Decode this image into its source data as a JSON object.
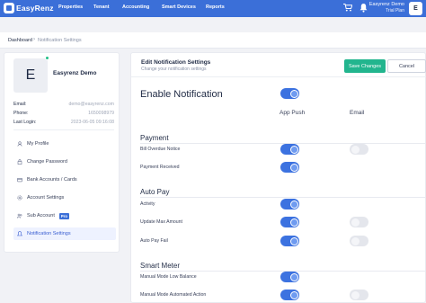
{
  "brand": {
    "name": "EasyRenz"
  },
  "nav": {
    "items": [
      "Properties",
      "Tenant",
      "Accounting",
      "Smart Devices",
      "Reports"
    ]
  },
  "topuser": {
    "name": "Easyrenz Demo",
    "plan": "Trial Plan",
    "avatar": "E"
  },
  "breadcrumb": {
    "home": "Dashboard",
    "sep": "›",
    "current": "Notification Settings"
  },
  "profile": {
    "avatar": "E",
    "name": "Easyrenz Demo",
    "email_label": "Email:",
    "email": "demo@easyrenz.com",
    "phone_label": "Phone:",
    "phone": "1650098979",
    "login_label": "Last Login:",
    "login": "2023-06-05 09:16:08"
  },
  "menu": {
    "items": [
      "My Profile",
      "Change Password",
      "Bank Accounts / Cards",
      "Account Settings",
      "Sub Account",
      "Notification Settings"
    ],
    "pro_badge": "Pro"
  },
  "main": {
    "title": "Edit Notification Settings",
    "subtitle": "Change your notification settings",
    "save": "Save Changes",
    "cancel": "Cancel",
    "enable": "Enable Notification",
    "col_app": "App Push",
    "col_email": "Email",
    "payment": {
      "title": "Payment",
      "rows": [
        "Bill Overdue Notice",
        "Payment Received"
      ]
    },
    "autopay": {
      "title": "Auto Pay",
      "rows": [
        "Activity",
        "Update Max Amount",
        "Auto Pay Fail"
      ]
    },
    "smartmeter": {
      "title": "Smart Meter",
      "rows": [
        "Manual Mode Low Balance",
        "Manual Mode Automated Action"
      ]
    }
  },
  "toggles": {
    "enable": true,
    "bill_overdue": {
      "app": true,
      "email": false
    },
    "payment_received": {
      "app": true,
      "email": null
    },
    "activity": {
      "app": true,
      "email": null
    },
    "update_max": {
      "app": true,
      "email": false
    },
    "autopay_fail": {
      "app": true,
      "email": false
    },
    "low_balance": {
      "app": true,
      "email": null
    },
    "automated_action": {
      "app": true,
      "email": false
    }
  },
  "colors": {
    "primary": "#3b6fd8",
    "success": "#22b58e",
    "toggle_on": "#3c72e0",
    "online": "#21c087"
  },
  "icons": [
    "cart-icon",
    "bell-icon",
    "user-icon",
    "lock-icon",
    "bank-icon",
    "settings-icon",
    "people-icon",
    "bell-icon"
  ]
}
